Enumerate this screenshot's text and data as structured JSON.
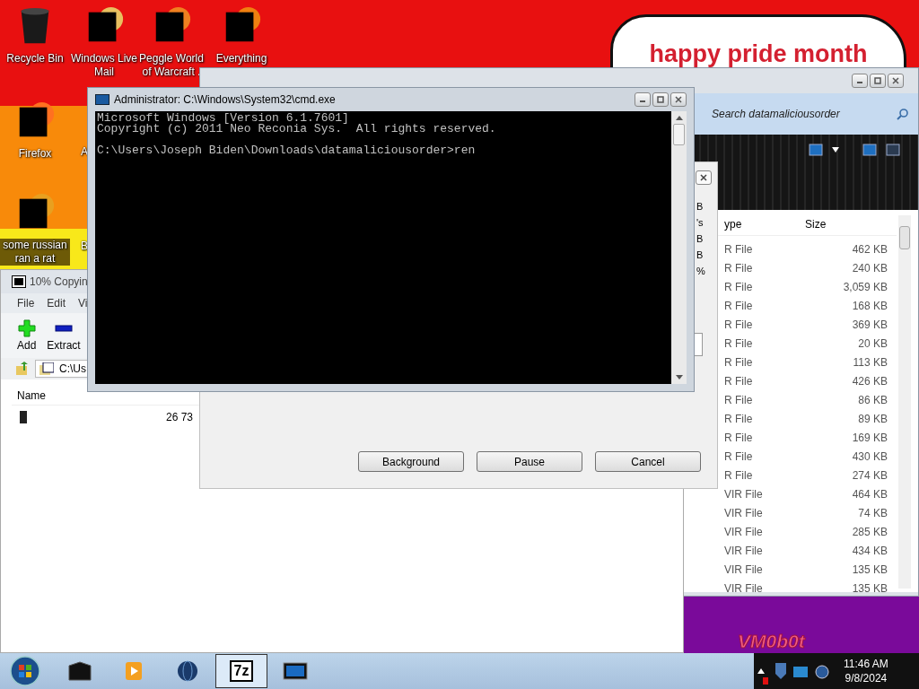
{
  "desktop": {
    "banner": "happy pride month",
    "wallpaper_mark": "VM0b0t",
    "icons": [
      {
        "label": "Recycle Bin",
        "kind": "full"
      },
      {
        "label": "Windows Live Mail",
        "kind": "full"
      },
      {
        "label": "Peggle World of Warcraft .",
        "kind": "full"
      },
      {
        "label": "Everything",
        "kind": "full"
      },
      {
        "label": "Firefox",
        "kind": "full"
      },
      {
        "label": "A",
        "kind": "partial"
      },
      {
        "label": "some russian ran a rat",
        "kind": "full"
      },
      {
        "label": "B",
        "kind": "partial"
      }
    ]
  },
  "explorer": {
    "search": {
      "placeholder": "Search datamaliciousorder"
    },
    "columns": [
      "ype",
      "Size"
    ],
    "rows": [
      {
        "type": "R File",
        "size": "462 KB"
      },
      {
        "type": "R File",
        "size": "240 KB"
      },
      {
        "type": "R File",
        "size": "3,059 KB"
      },
      {
        "type": "R File",
        "size": "168 KB"
      },
      {
        "type": "R File",
        "size": "369 KB"
      },
      {
        "type": "R File",
        "size": "20 KB"
      },
      {
        "type": "R File",
        "size": "113 KB"
      },
      {
        "type": "R File",
        "size": "426 KB"
      },
      {
        "type": "R File",
        "size": "86 KB"
      },
      {
        "type": "R File",
        "size": "89 KB"
      },
      {
        "type": "R File",
        "size": "169 KB"
      },
      {
        "type": "R File",
        "size": "430 KB"
      },
      {
        "type": "R File",
        "size": "274 KB"
      },
      {
        "type": "VIR File",
        "size": "464 KB"
      },
      {
        "type": "VIR File",
        "size": "74 KB"
      },
      {
        "type": "VIR File",
        "size": "285 KB"
      },
      {
        "type": "VIR File",
        "size": "434 KB"
      },
      {
        "type": "VIR File",
        "size": "135 KB"
      },
      {
        "type": "VIR File",
        "size": "135 KB"
      }
    ]
  },
  "copy_dialog": {
    "fragments": [
      "B",
      "'s",
      "B",
      "B",
      "%"
    ],
    "buttons": [
      "Background",
      "Pause",
      "Cancel"
    ]
  },
  "cmd": {
    "title": "Administrator: C:\\Windows\\System32\\cmd.exe",
    "lines": [
      "Microsoft Windows [Version 6.1.7601]",
      "Copyright (c) 2011 Neo Reconia Sys.  All rights reserved."
    ],
    "prompt": "C:\\Users\\Joseph Biden\\Downloads\\datamaliciousorder>ren"
  },
  "sevenzip": {
    "title": "10% Copyin",
    "menu": [
      "File",
      "Edit",
      "Vi"
    ],
    "tools": [
      {
        "label": "Add",
        "kind": "add"
      },
      {
        "label": "Extract",
        "kind": "extract"
      }
    ],
    "address": "C:\\Us",
    "columns": [
      "Name"
    ],
    "rows": [
      {
        "size": "26 73"
      }
    ]
  },
  "taskbar": {
    "tasks": [
      {
        "kind": "box",
        "selected": false
      },
      {
        "kind": "media",
        "selected": false
      },
      {
        "kind": "globe",
        "selected": false
      },
      {
        "kind": "archive",
        "label": "7z",
        "selected": true
      },
      {
        "kind": "console",
        "selected": false
      }
    ],
    "clock": {
      "time": "11:46 AM",
      "date": "9/8/2024"
    }
  }
}
